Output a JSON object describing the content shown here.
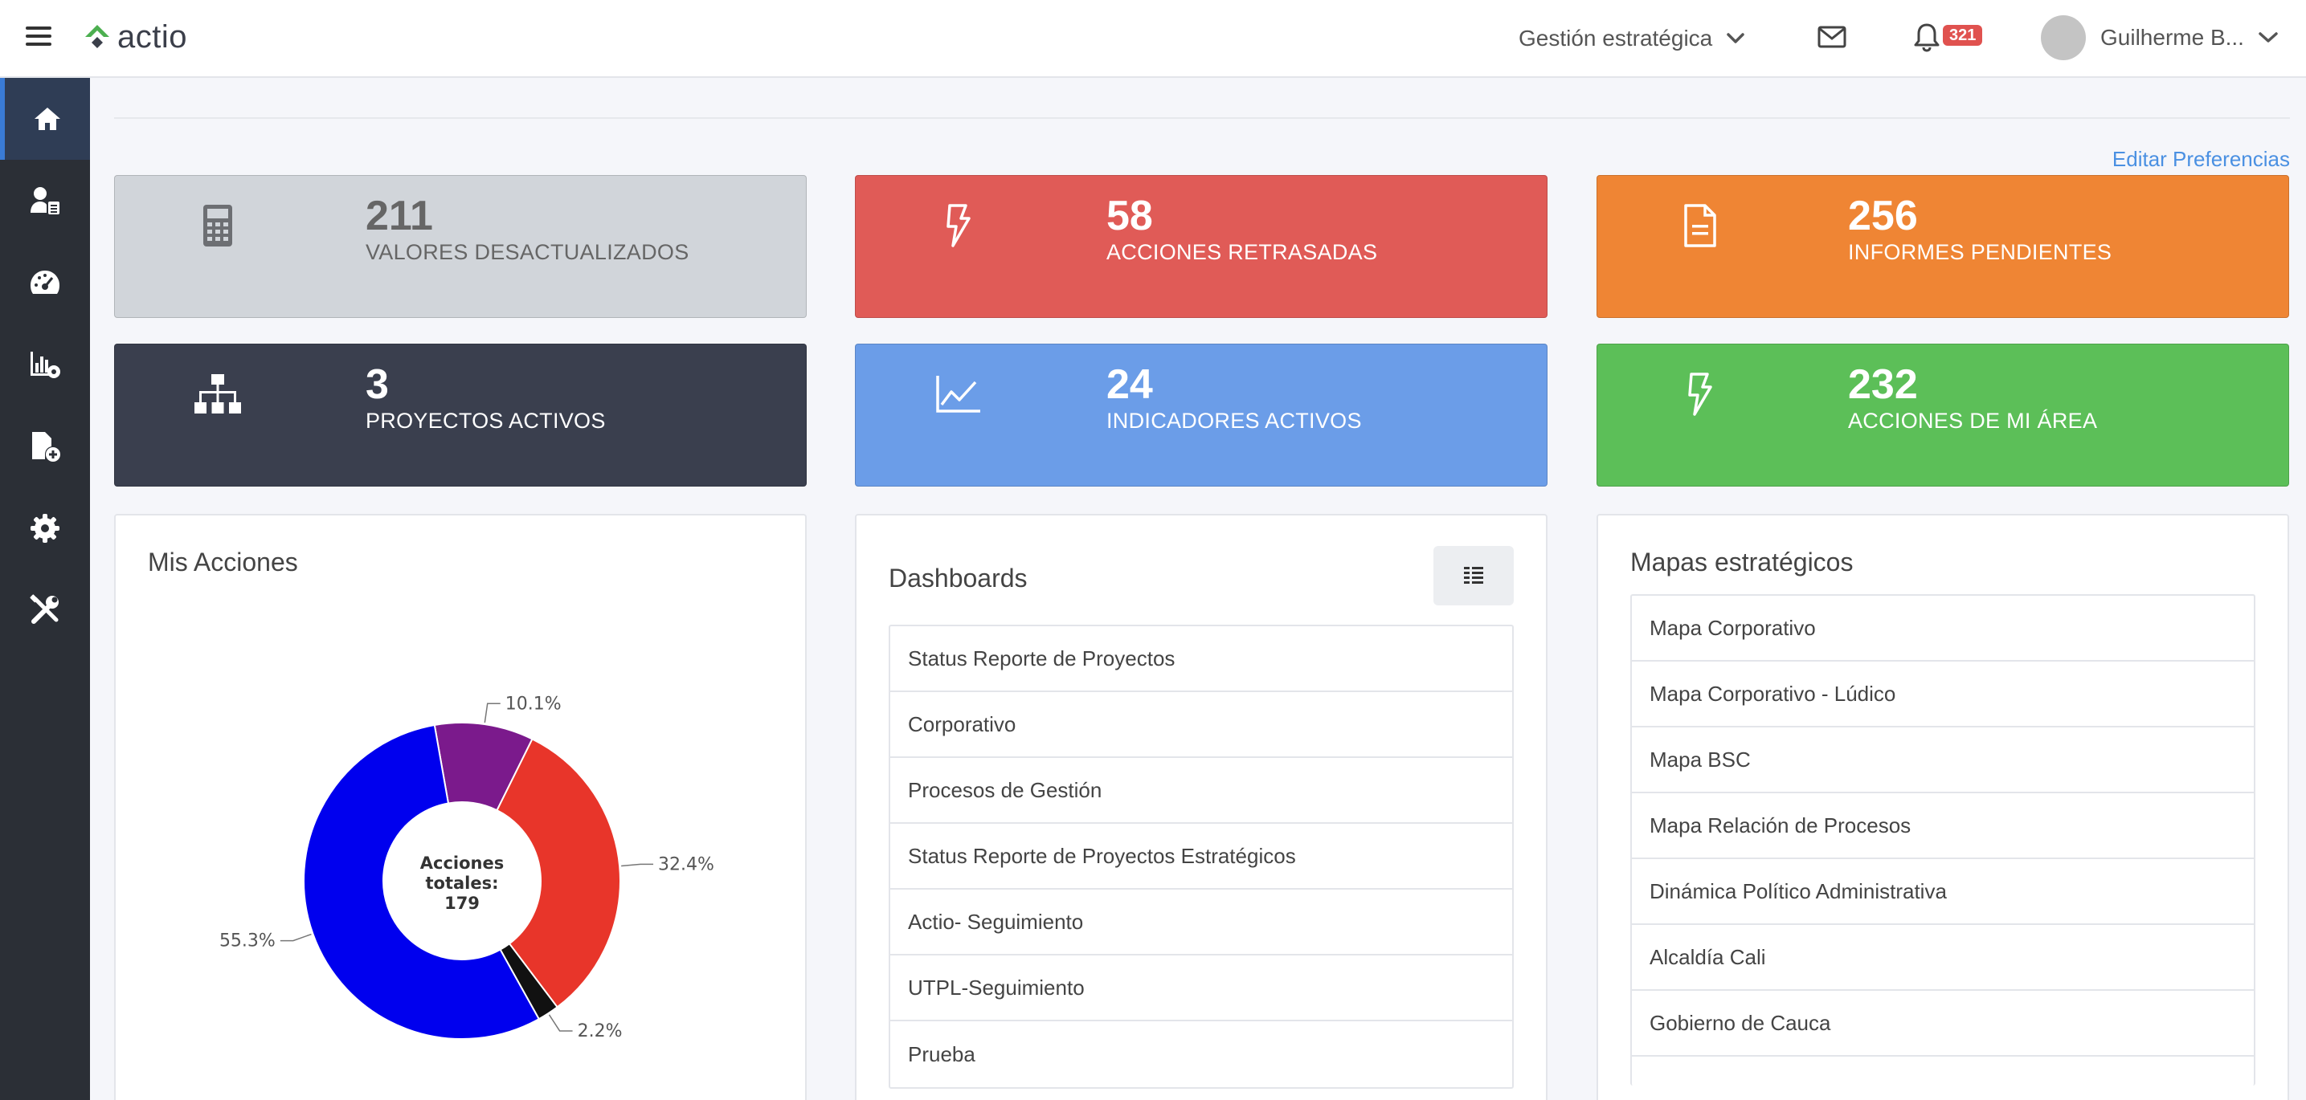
{
  "header": {
    "logo_text": "actio",
    "module_select": "Gestión estratégica",
    "notifications_count": "321",
    "user_name": "Guilherme B..."
  },
  "sidebar": {
    "items": [
      {
        "icon": "home-icon",
        "active": true
      },
      {
        "icon": "user-list-icon",
        "active": false
      },
      {
        "icon": "dashboard-gauge-icon",
        "active": false
      },
      {
        "icon": "chart-settings-icon",
        "active": false
      },
      {
        "icon": "file-add-icon",
        "active": false
      },
      {
        "icon": "gear-icon",
        "active": false
      },
      {
        "icon": "tools-icon",
        "active": false
      }
    ]
  },
  "edit_preferences": "Editar Preferencias",
  "cards": [
    {
      "value": "211",
      "label": "VALORES DESACTUALIZADOS",
      "icon": "calculator-icon",
      "color": "#d1d5da"
    },
    {
      "value": "58",
      "label": "ACCIONES RETRASADAS",
      "icon": "bolt-icon",
      "color": "#e05b57"
    },
    {
      "value": "256",
      "label": "INFORMES PENDIENTES",
      "icon": "document-icon",
      "color": "#ef8534"
    },
    {
      "value": "3",
      "label": "PROYECTOS ACTIVOS",
      "icon": "sitemap-icon",
      "color": "#3a3f4e"
    },
    {
      "value": "24",
      "label": "INDICADORES ACTIVOS",
      "icon": "line-chart-icon",
      "color": "#6b9de8"
    },
    {
      "value": "232",
      "label": "ACCIONES DE MI ÁREA",
      "icon": "bolt-icon",
      "color": "#5cbf58"
    }
  ],
  "mis_acciones": {
    "title": "Mis Acciones",
    "center_line1": "Acciones",
    "center_line2": "totales:",
    "center_line3": "179"
  },
  "chart_data": {
    "type": "pie",
    "title": "Mis Acciones",
    "total": 179,
    "slices": [
      {
        "value": 10.1,
        "label": "10.1%",
        "color": "#7b1a8c"
      },
      {
        "value": 32.4,
        "label": "32.4%",
        "color": "#e8352a"
      },
      {
        "value": 2.2,
        "label": "2.2%",
        "color": "#111111"
      },
      {
        "value": 55.3,
        "label": "55.3%",
        "color": "#0000ee"
      }
    ]
  },
  "dashboards": {
    "title": "Dashboards",
    "items": [
      "Status Reporte de Proyectos",
      "Corporativo",
      "Procesos de Gestión",
      "Status Reporte de Proyectos Estratégicos",
      "Actio- Seguimiento",
      "UTPL-Seguimiento",
      "Prueba"
    ]
  },
  "mapas": {
    "title": "Mapas estratégicos",
    "items": [
      "Mapa Corporativo",
      "Mapa Corporativo - Lúdico",
      "Mapa BSC",
      "Mapa Relación de Procesos",
      "Dinámica Político Administrativa",
      "Alcaldía Cali",
      "Gobierno de Cauca",
      ""
    ]
  }
}
